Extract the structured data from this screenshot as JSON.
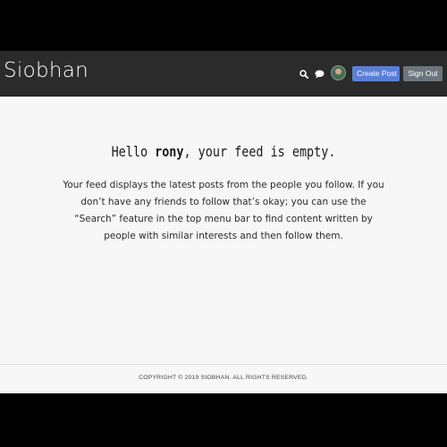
{
  "header": {
    "brand": "Siobhan",
    "icons": [
      "search-icon",
      "chat-icon"
    ],
    "create_post_label": "Create Post",
    "sign_out_label": "Sign Out",
    "colors": {
      "bar": "#2b2b2b",
      "create_button": "#5b7fd6",
      "sign_out_button": "#6c757d"
    }
  },
  "main": {
    "headline_pre": "Hello ",
    "headline_user": "rony",
    "headline_post": ", your feed is empty.",
    "description": "Your feed displays the latest posts from the people you follow. If you don’t have any friends to follow that’s okay; you can use the “Search” feature in the top menu bar to find content written by people with similar interests and then follow them."
  },
  "footer": {
    "copyright": "COPYRIGHT © 2019 SIOBHAN. ALL RIGHTS RESERVED."
  }
}
